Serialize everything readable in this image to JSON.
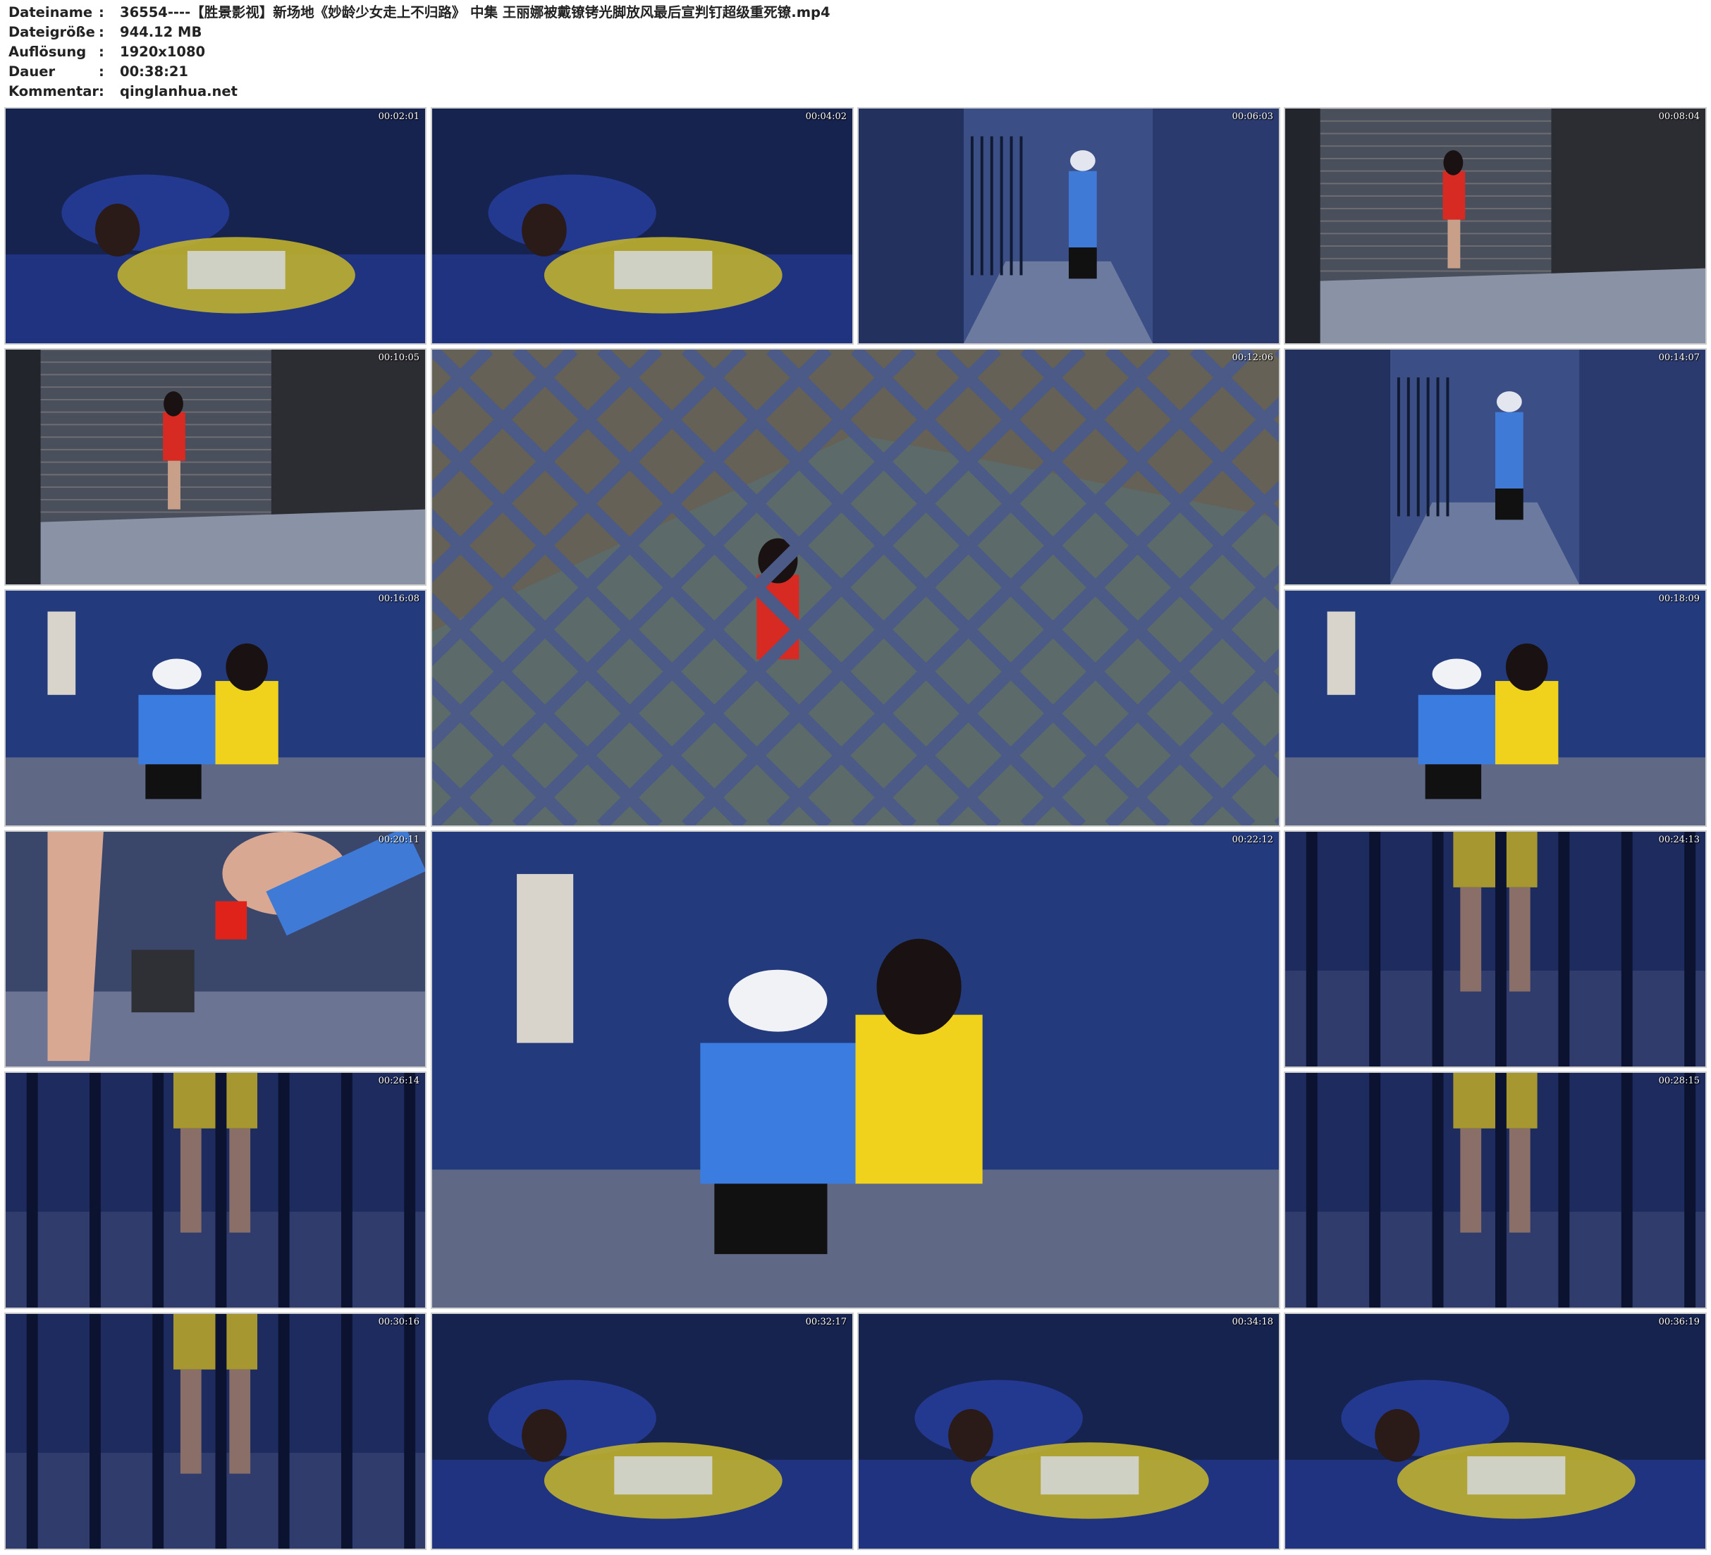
{
  "info": [
    {
      "key": "Dateiname",
      "value": "36554----【胜景影视】新场地《妙龄少女走上不归路》 中集 王丽娜被戴镣铐光脚放风最后宣判钉超级重死镣.mp4"
    },
    {
      "key": "Dateigröße",
      "value": "944.12 MB"
    },
    {
      "key": "Auflösung",
      "value": "1920x1080"
    },
    {
      "key": "Dauer",
      "value": "00:38:21"
    },
    {
      "key": "Kommentar",
      "value": "qinglanhua.net"
    }
  ],
  "separator": ":",
  "thumbnails": [
    {
      "time": "00:02:01",
      "scene": "bed"
    },
    {
      "time": "00:04:02",
      "scene": "bed"
    },
    {
      "time": "00:06:03",
      "scene": "corridor"
    },
    {
      "time": "00:08:04",
      "scene": "yard"
    },
    {
      "time": "00:10:05",
      "scene": "yard"
    },
    {
      "time": "00:12:06",
      "scene": "grid"
    },
    {
      "time": "00:14:07",
      "scene": "corridor"
    },
    {
      "time": "00:16:08",
      "scene": "room"
    },
    {
      "time": "00:18:09",
      "scene": "room"
    },
    {
      "time": "00:20:11",
      "scene": "closeup"
    },
    {
      "time": "00:22:12",
      "scene": "room"
    },
    {
      "time": "00:24:13",
      "scene": "bars"
    },
    {
      "time": "00:26:14",
      "scene": "bars"
    },
    {
      "time": "00:28:15",
      "scene": "bars"
    },
    {
      "time": "00:30:16",
      "scene": "bars"
    },
    {
      "time": "00:32:17",
      "scene": "bed"
    },
    {
      "time": "00:34:18",
      "scene": "bed"
    },
    {
      "time": "00:36:19",
      "scene": "bed"
    }
  ],
  "colors": {
    "background": "#ffffff",
    "text": "#222222",
    "timestamp": "#ffffff",
    "thumb_border": "#cfcfcf",
    "scene_blue": "#1e2d62"
  }
}
